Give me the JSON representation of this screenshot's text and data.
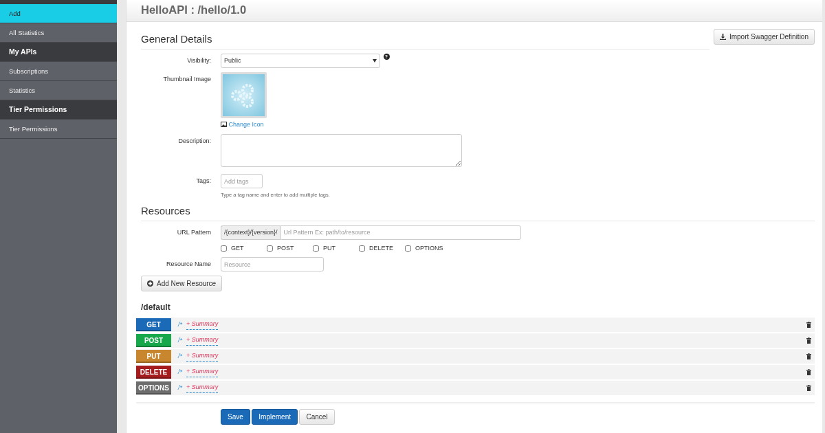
{
  "sidebar": {
    "items": [
      {
        "label": "Add",
        "kind": "item",
        "selected": true
      },
      {
        "label": "All Statistics",
        "kind": "item",
        "selected": false
      },
      {
        "label": "My APIs",
        "kind": "header"
      },
      {
        "label": "Subscriptions",
        "kind": "item",
        "selected": false
      },
      {
        "label": "Statistics",
        "kind": "item",
        "selected": false
      },
      {
        "label": "Tier Permissions",
        "kind": "header"
      },
      {
        "label": "Tier Permissions",
        "kind": "item",
        "selected": false
      }
    ]
  },
  "page_title": "HelloAPI : /hello/1.0",
  "general": {
    "heading": "General Details",
    "import_button": "Import Swagger Definition",
    "visibility": {
      "label": "Visibility:",
      "value": "Public",
      "help_icon": "?"
    },
    "thumbnail": {
      "label": "Thumbnail Image",
      "link": "Change Icon"
    },
    "description": {
      "label": "Description:"
    },
    "tags": {
      "label": "Tags:",
      "placeholder": "Add tags",
      "help": "Type a tag name and enter to add multiple tags."
    }
  },
  "resources": {
    "heading": "Resources",
    "url_pattern": {
      "label": "URL Pattern",
      "prefix": "/{context}/{version}/",
      "placeholder": "Url Pattern Ex: path/to/resource"
    },
    "methods": [
      {
        "label": "GET",
        "checked": false
      },
      {
        "label": "POST",
        "checked": false
      },
      {
        "label": "PUT",
        "checked": false
      },
      {
        "label": "DELETE",
        "checked": false
      },
      {
        "label": "OPTIONS",
        "checked": false
      }
    ],
    "resource_name": {
      "label": "Resource Name",
      "placeholder": "Resource"
    },
    "add_button": "Add New Resource"
  },
  "default_group": {
    "title": "/default",
    "rows": [
      {
        "method": "GET",
        "color": "#1a6ab8",
        "path": "/*",
        "summary": "+ Summary"
      },
      {
        "method": "POST",
        "color": "#17a84b",
        "path": "/*",
        "summary": "+ Summary"
      },
      {
        "method": "PUT",
        "color": "#c8872e",
        "path": "/*",
        "summary": "+ Summary"
      },
      {
        "method": "DELETE",
        "color": "#a51c1f",
        "path": "/*",
        "summary": "+ Summary"
      },
      {
        "method": "OPTIONS",
        "color": "#6d6d6d",
        "path": "/*",
        "summary": "+ Summary"
      }
    ]
  },
  "actions": [
    {
      "label": "Save",
      "kind": "primary"
    },
    {
      "label": "Implement",
      "kind": "primary"
    },
    {
      "label": "Cancel",
      "kind": "default"
    }
  ]
}
